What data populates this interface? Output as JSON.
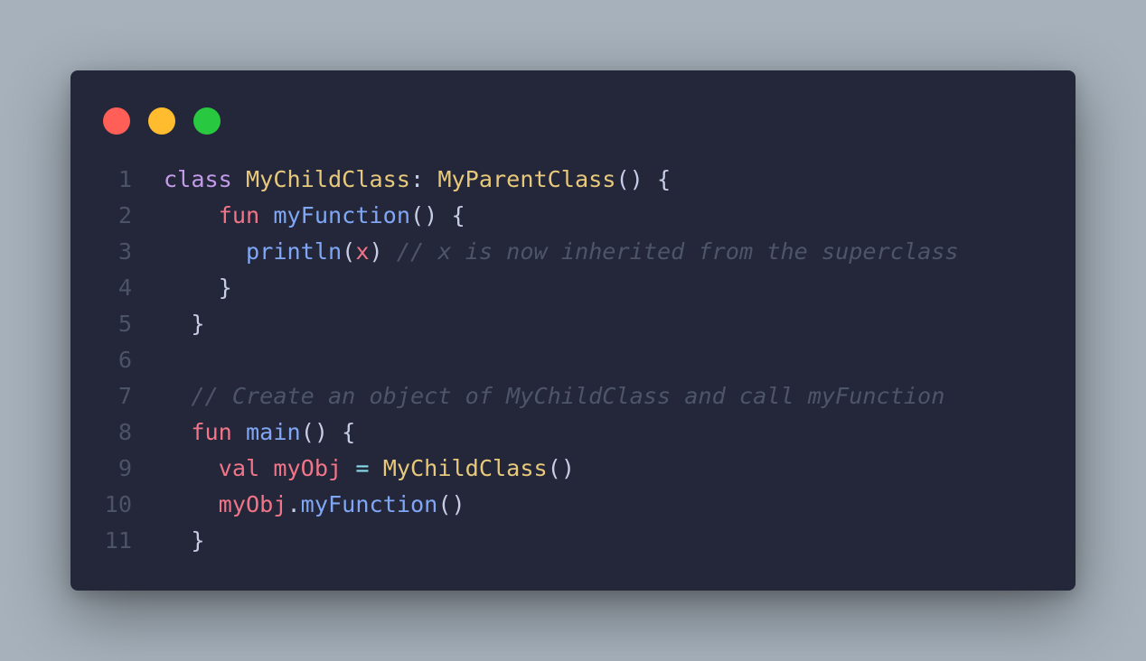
{
  "window_controls": {
    "close_color": "#ff5f57",
    "minimize_color": "#febc2e",
    "maximize_color": "#28c840"
  },
  "theme": {
    "background": "#232739",
    "keyword_color": "#f07588",
    "class_color": "#e8c97c",
    "function_color": "#80a7f5",
    "comment_color": "#4f5569"
  },
  "code": {
    "lines": [
      {
        "number": "1",
        "tokens": [
          {
            "t": "class",
            "c": "kw1"
          },
          {
            "t": " ",
            "c": "p"
          },
          {
            "t": "MyChildClass",
            "c": "cls"
          },
          {
            "t": ": ",
            "c": "p"
          },
          {
            "t": "MyParentClass",
            "c": "cls"
          },
          {
            "t": "() {",
            "c": "p"
          }
        ]
      },
      {
        "number": "2",
        "tokens": [
          {
            "t": "    ",
            "c": "p"
          },
          {
            "t": "fun",
            "c": "kw"
          },
          {
            "t": " ",
            "c": "p"
          },
          {
            "t": "myFunction",
            "c": "fn"
          },
          {
            "t": "() {",
            "c": "p"
          }
        ]
      },
      {
        "number": "3",
        "tokens": [
          {
            "t": "      ",
            "c": "p"
          },
          {
            "t": "println",
            "c": "fn"
          },
          {
            "t": "(",
            "c": "p"
          },
          {
            "t": "x",
            "c": "var"
          },
          {
            "t": ") ",
            "c": "p"
          },
          {
            "t": "// x is now inherited from the superclass",
            "c": "cm"
          }
        ]
      },
      {
        "number": "4",
        "tokens": [
          {
            "t": "    }",
            "c": "p"
          }
        ]
      },
      {
        "number": "5",
        "tokens": [
          {
            "t": "  }",
            "c": "p"
          }
        ]
      },
      {
        "number": "6",
        "tokens": []
      },
      {
        "number": "7",
        "tokens": [
          {
            "t": "  ",
            "c": "p"
          },
          {
            "t": "// Create an object of MyChildClass and call myFunction",
            "c": "cm"
          }
        ]
      },
      {
        "number": "8",
        "tokens": [
          {
            "t": "  ",
            "c": "p"
          },
          {
            "t": "fun",
            "c": "kw"
          },
          {
            "t": " ",
            "c": "p"
          },
          {
            "t": "main",
            "c": "fn"
          },
          {
            "t": "() {",
            "c": "p"
          }
        ]
      },
      {
        "number": "9",
        "tokens": [
          {
            "t": "    ",
            "c": "p"
          },
          {
            "t": "val",
            "c": "kw"
          },
          {
            "t": " ",
            "c": "p"
          },
          {
            "t": "myObj",
            "c": "var"
          },
          {
            "t": " ",
            "c": "p"
          },
          {
            "t": "=",
            "c": "op"
          },
          {
            "t": " ",
            "c": "p"
          },
          {
            "t": "MyChildClass",
            "c": "cls"
          },
          {
            "t": "()",
            "c": "p"
          }
        ]
      },
      {
        "number": "10",
        "tokens": [
          {
            "t": "    ",
            "c": "p"
          },
          {
            "t": "myObj",
            "c": "var"
          },
          {
            "t": ".",
            "c": "p"
          },
          {
            "t": "myFunction",
            "c": "fn"
          },
          {
            "t": "()",
            "c": "p"
          }
        ]
      },
      {
        "number": "11",
        "tokens": [
          {
            "t": "  }",
            "c": "p"
          }
        ]
      }
    ]
  }
}
